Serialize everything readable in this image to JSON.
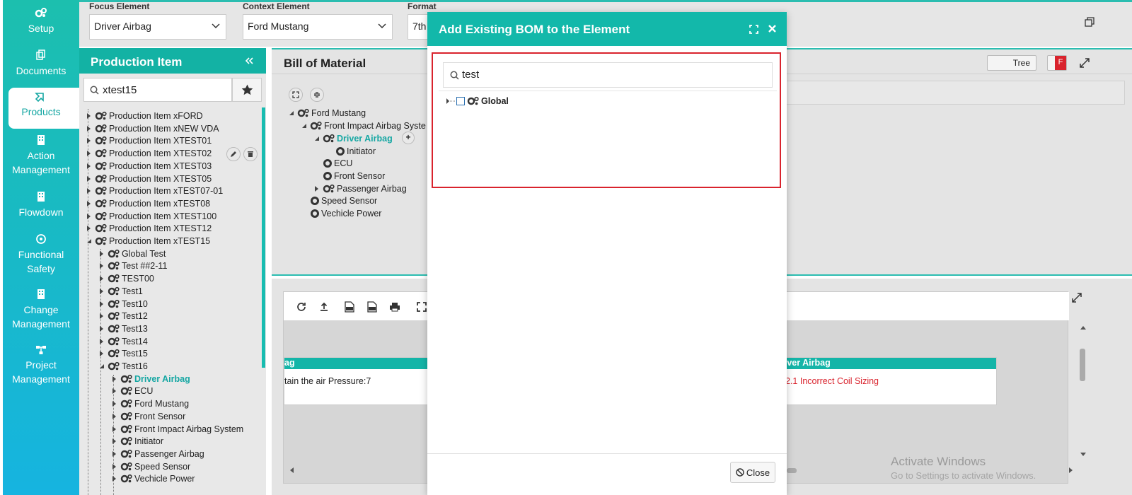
{
  "nav": {
    "items": [
      {
        "label": "Setup",
        "icon": "gears-icon"
      },
      {
        "label": "Documents",
        "icon": "documents-icon"
      },
      {
        "label": "Products",
        "icon": "products-icon",
        "active": true
      },
      {
        "label": "Action Management",
        "icon": "building-icon"
      },
      {
        "label": "Flowdown",
        "icon": "building-icon"
      },
      {
        "label": "Functional Safety",
        "icon": "safety-icon"
      },
      {
        "label": "Change Management",
        "icon": "building-icon"
      },
      {
        "label": "Project Management",
        "icon": "hierarchy-icon"
      }
    ]
  },
  "topbar": {
    "focus_label": "Focus Element",
    "focus_value": "Driver Airbag",
    "context_label": "Context Element",
    "context_value": "Ford Mustang",
    "format_label": "Format",
    "format_value": "7th"
  },
  "production": {
    "title": "Production Item",
    "search_value": "xtest15",
    "items": [
      "Production Item xFORD",
      "Production Item xNEW VDA",
      "Production Item XTEST01",
      "Production Item XTEST02",
      "Production Item XTEST03",
      "Production Item XTEST05",
      "Production Item xTEST07-01",
      "Production Item xTEST08",
      "Production Item XTEST100",
      "Production Item XTEST12",
      "Production Item xTEST15"
    ],
    "children": [
      "Global Test",
      "Test ##2-11",
      "TEST00",
      "Test1",
      "Test10",
      "Test12",
      "Test13",
      "Test14",
      "Test15",
      "Test16"
    ],
    "grandchildren": [
      "Driver Airbag",
      "ECU",
      "Ford Mustang",
      "Front Sensor",
      "Front Impact Airbag System",
      "Initiator",
      "Passenger Airbag",
      "Speed Sensor",
      "Vechicle Power"
    ]
  },
  "bom": {
    "title": "Bill of Material",
    "tree_toggle": "Tree",
    "f_toggle": "F",
    "tree": [
      "Ford Mustang",
      "Front Impact Airbag Syste",
      "Driver Airbag",
      "Initiator",
      "ECU",
      "Front Sensor",
      "Passenger Airbag",
      "Speed Sensor",
      "Vechicle Power"
    ]
  },
  "bottom": {
    "card1_header": "ag",
    "card1_text": "tain the air Pressure:7",
    "card2_header": "river Airbag",
    "card2_text": "2.1 Incorrect Coil Sizing",
    "watermark_title": "Activate Windows",
    "watermark_sub": "Go to Settings to activate Windows."
  },
  "modal": {
    "title": "Add Existing BOM to the Element",
    "search_value": "test",
    "tree_item": "Global",
    "close_label": "Close"
  },
  "colors": {
    "teal": "#13b8aa",
    "highlight_red": "#d9232d",
    "link_teal": "#16a7a3"
  }
}
